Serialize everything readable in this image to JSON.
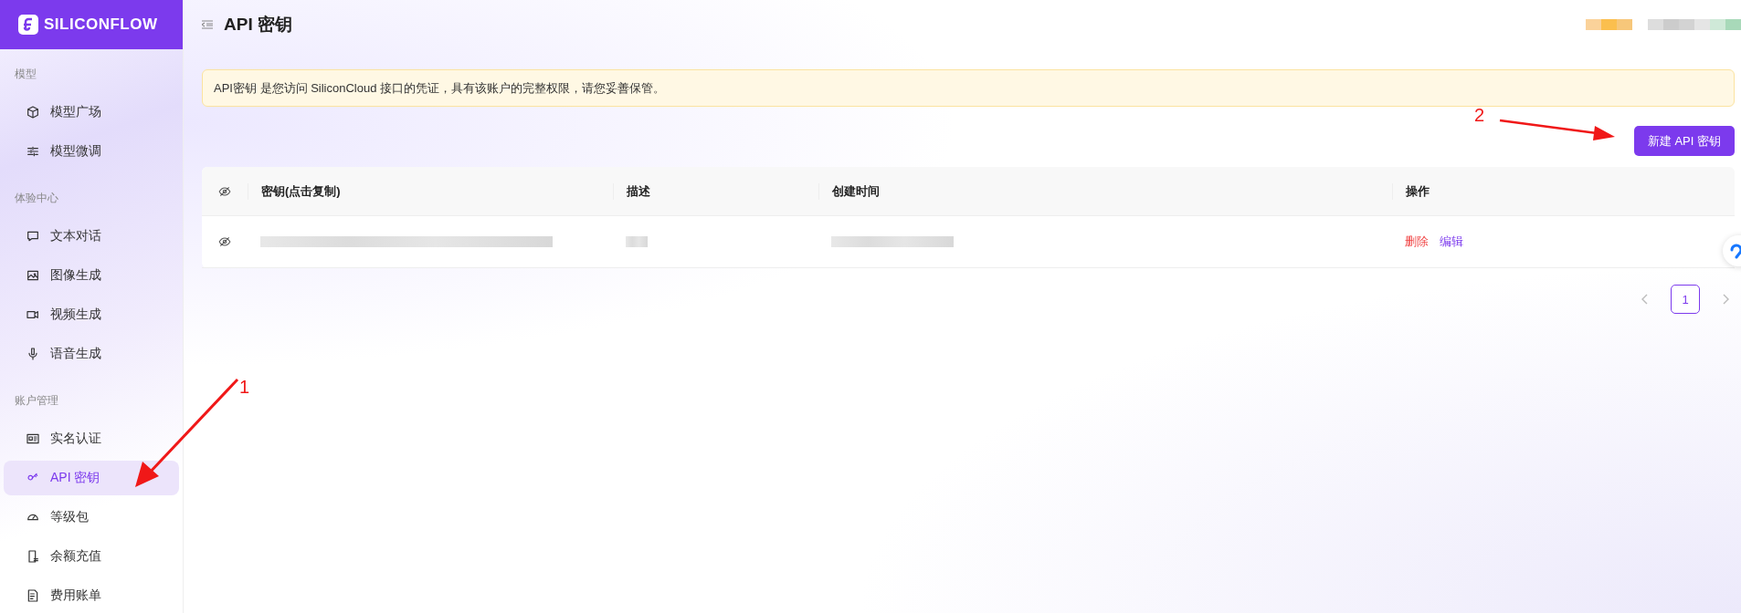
{
  "logo": {
    "text": "SILICONFLOW"
  },
  "sidebar": {
    "sections": [
      {
        "label": "模型",
        "items": [
          {
            "label": "模型广场",
            "selected": false
          },
          {
            "label": "模型微调",
            "selected": false
          }
        ]
      },
      {
        "label": "体验中心",
        "items": [
          {
            "label": "文本对话",
            "selected": false
          },
          {
            "label": "图像生成",
            "selected": false
          },
          {
            "label": "视频生成",
            "selected": false
          },
          {
            "label": "语音生成",
            "selected": false
          }
        ]
      },
      {
        "label": "账户管理",
        "items": [
          {
            "label": "实名认证",
            "selected": false
          },
          {
            "label": "API 密钥",
            "selected": true
          },
          {
            "label": "等级包",
            "selected": false
          },
          {
            "label": "余额充值",
            "selected": false
          },
          {
            "label": "费用账单",
            "selected": false
          }
        ]
      }
    ]
  },
  "header": {
    "title": "API 密钥"
  },
  "notice": {
    "text": "API密钥 是您访问 SiliconCloud 接口的凭证，具有该账户的完整权限，请您妥善保管。"
  },
  "create_button": {
    "label": "新建 API 密钥"
  },
  "table": {
    "columns": [
      {
        "label": "密钥(点击复制)"
      },
      {
        "label": "描述"
      },
      {
        "label": "创建时间"
      },
      {
        "label": "操作"
      }
    ],
    "rows": [
      {
        "actions": [
          {
            "label": "删除",
            "kind": "danger"
          },
          {
            "label": "编辑",
            "kind": "link"
          }
        ]
      }
    ]
  },
  "pagination": {
    "pages": [
      {
        "label": "1",
        "selected": true
      }
    ]
  },
  "annotations": [
    {
      "label": "1"
    },
    {
      "label": "2"
    }
  ]
}
